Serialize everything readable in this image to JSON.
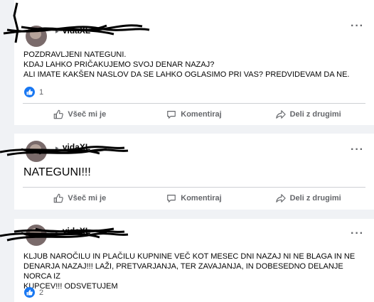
{
  "posts": [
    {
      "author": {
        "name": "",
        "arrow": "▸",
        "page": "vidaXL"
      },
      "text_lines": [
        "POZDRAVLJENI NATEGUNI.",
        "KDAJ LAHKO PRIČAKUJEMO SVOJ DENAR NAZAJ?",
        "ALI IMATE KAKŠEN NASLOV DA SE LAHKO OGLASIMO PRI VAS? PREDVIDEVAM DA NE."
      ],
      "reactions": "1"
    },
    {
      "author": {
        "name": "",
        "arrow": "▸",
        "page": "vidaXL"
      },
      "text": "NATEGUNI!!!"
    },
    {
      "author": {
        "name": "",
        "arrow": "▸",
        "page": "vidaXL"
      },
      "text_lines": [
        "KLJUB NAROČILU IN PLAČILU KUPNINE VEČ KOT MESEC DNI NAZAJ NI NE BLAGA IN NE",
        "DENARJA NAZAJ!!! LAŽI, PRETVARJANJA, TER ZAVAJANJA, IN DOBESEDNO DELANJE NORCA IZ",
        "KUPCEV!!! ODSVETUJEM"
      ],
      "reactions": "2"
    }
  ],
  "actions": {
    "like": "Všeč mi je",
    "comment": "Komentiraj",
    "share": "Deli z drugimi"
  },
  "menu_glyph": "···",
  "colors": {
    "like_blue": "#1877f2",
    "muted": "#65676b",
    "background": "#f0f2f5"
  }
}
